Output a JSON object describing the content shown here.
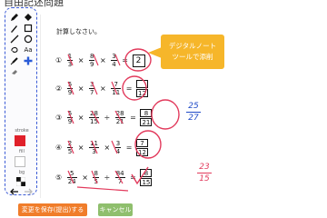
{
  "header": {
    "title": "自由記述問題"
  },
  "toolbar": {
    "tools": [
      {
        "icon": "pen-icon"
      },
      {
        "icon": "fill-diamond-icon"
      },
      {
        "icon": "marker-icon"
      },
      {
        "icon": "rectangle-icon"
      },
      {
        "icon": "line-icon"
      },
      {
        "icon": "circle-icon"
      },
      {
        "icon": "lasso-icon"
      },
      {
        "icon": "text-tool-icon",
        "label": "Aa"
      },
      {
        "icon": "highlighter-icon"
      },
      {
        "icon": "move-cross-icon"
      },
      {
        "icon": "eraser-icon"
      }
    ],
    "stroke_label": "stroke",
    "fill_label": "fill",
    "bg_label": "bg",
    "stroke_color": "#e0202a",
    "fill_color": "#ffffff",
    "undo_icon": "undo-icon",
    "redo_icon": "redo-icon"
  },
  "canvas": {
    "instruction": "計算しなさい。",
    "callout": {
      "line1": "デジタルノート",
      "line2": "ツールで添削",
      "color": "#f6b62a"
    },
    "problems": [
      {
        "num": "①",
        "a": [
          "1",
          "3"
        ],
        "b": [
          "8",
          "9"
        ],
        "c": [
          "3",
          "4"
        ],
        "answer": "2"
      },
      {
        "num": "②",
        "a": [
          "5",
          "9"
        ],
        "b": [
          "3",
          "7"
        ],
        "c": [
          "7",
          "11"
        ],
        "answer_num": "",
        "answer_den": "12"
      },
      {
        "num": "③",
        "a": [
          "5",
          "9"
        ],
        "b": [
          "28",
          "15"
        ],
        "c": [
          "28",
          "21"
        ],
        "answer_num": "8",
        "answer_den": "21"
      },
      {
        "num": "④",
        "a": [
          "2",
          "5"
        ],
        "b": [
          "11",
          "3"
        ],
        "c": [
          "3",
          "4"
        ],
        "answer_num": "7",
        "answer_den": "12"
      },
      {
        "num": "⑤",
        "a": [
          "5",
          "24"
        ],
        "b": [
          "8",
          "5"
        ],
        "c": [
          "84",
          "7"
        ],
        "answer_num": "8",
        "answer_den": "15"
      }
    ],
    "handwriting": {
      "corr3_num": "25",
      "corr3_den": "27",
      "corr5_num": "23",
      "corr5_den": "15",
      "ink_blue": "#1e49c7",
      "ink_red": "#e23a5c"
    }
  },
  "actions": {
    "submit_label": "変更を保存(提出)する",
    "cancel_label": "キャンセル",
    "submit_color": "#f07d2a",
    "cancel_color": "#8fbf6d"
  }
}
